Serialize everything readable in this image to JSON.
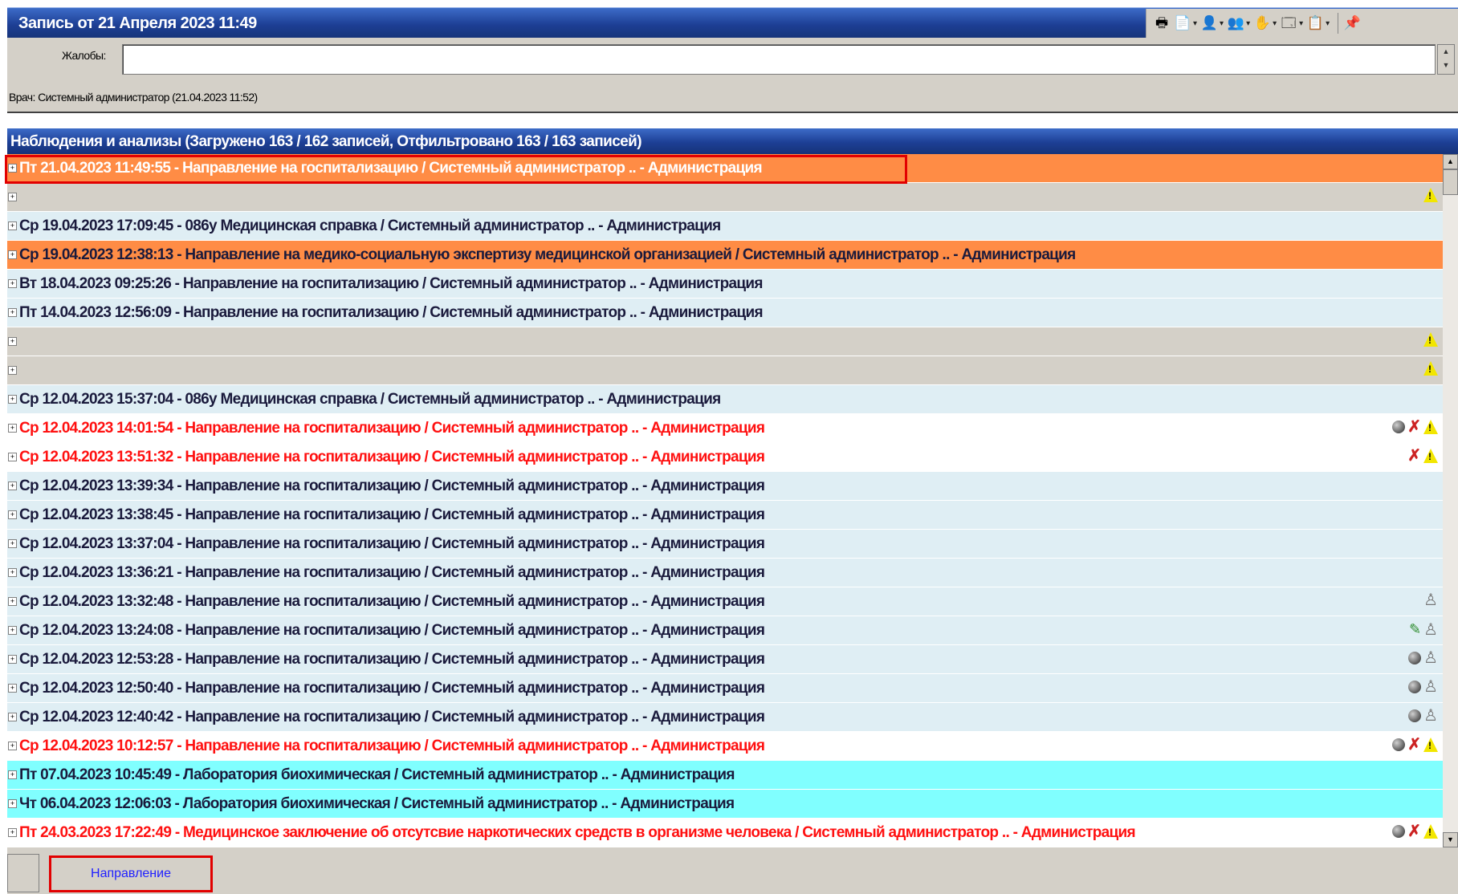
{
  "title": "Запись от 21 Апреля 2023 11:49",
  "toolbar": {
    "buttons": [
      {
        "name": "print-icon",
        "glyph": "🖶"
      },
      {
        "name": "document-icon",
        "glyph": "📄"
      },
      {
        "name": "doctor-icon",
        "glyph": "👤"
      },
      {
        "name": "doctors-icon",
        "glyph": "👥"
      },
      {
        "name": "hand-icon",
        "glyph": "✋"
      },
      {
        "name": "window-icon",
        "glyph": "🗔"
      },
      {
        "name": "copy-icon",
        "glyph": "📋"
      },
      {
        "name": "pin-icon",
        "glyph": "📌"
      }
    ]
  },
  "complaints": {
    "label": "Жалобы:",
    "value": ""
  },
  "doctor_line": "Врач: Системный администратор  (21.04.2023 11:52)",
  "observations_header": "Наблюдения и анализы (Загружено 163 / 162 записей, Отфильтровано 163 / 163 записей)",
  "rows": [
    {
      "text": "Пт 21.04.2023 11:49:55 - Направление на госпитализацию / Системный администратор .. - Администрация",
      "bg": "orange",
      "fg": "white",
      "icons": []
    },
    {
      "text": "",
      "bg": "gray",
      "fg": "dark",
      "icons": [
        "warn"
      ]
    },
    {
      "text": "Ср 19.04.2023 17:09:45 - 086у Медицинская справка / Системный администратор .. - Администрация",
      "bg": "light",
      "fg": "dark",
      "icons": []
    },
    {
      "text": "Ср 19.04.2023 12:38:13 - Направление на медико-социальную экспертизу медицинской организацией / Системный администратор .. - Администрация",
      "bg": "orange",
      "fg": "dark",
      "icons": []
    },
    {
      "text": "Вт 18.04.2023 09:25:26 - Направление на госпитализацию / Системный администратор .. - Администрация",
      "bg": "light",
      "fg": "dark",
      "icons": []
    },
    {
      "text": "Пт 14.04.2023 12:56:09 - Направление на госпитализацию / Системный администратор .. - Администрация",
      "bg": "light",
      "fg": "dark",
      "icons": []
    },
    {
      "text": "",
      "bg": "gray",
      "fg": "dark",
      "icons": [
        "warn"
      ]
    },
    {
      "text": "",
      "bg": "gray",
      "fg": "dark",
      "icons": [
        "warn"
      ]
    },
    {
      "text": "Ср 12.04.2023 15:37:04 - 086у Медицинская справка / Системный администратор .. - Администрация",
      "bg": "light",
      "fg": "dark",
      "icons": []
    },
    {
      "text": "Ср 12.04.2023 14:01:54 - Направление на госпитализацию / Системный администратор .. - Администрация",
      "bg": "white",
      "fg": "red",
      "icons": [
        "globe",
        "person-x",
        "warn"
      ]
    },
    {
      "text": "Ср 12.04.2023 13:51:32 - Направление на госпитализацию / Системный администратор .. - Администрация",
      "bg": "white",
      "fg": "red",
      "icons": [
        "person-x",
        "warn"
      ]
    },
    {
      "text": "Ср 12.04.2023 13:39:34 - Направление на госпитализацию / Системный администратор .. - Администрация",
      "bg": "light",
      "fg": "dark",
      "icons": []
    },
    {
      "text": "Ср 12.04.2023 13:38:45 - Направление на госпитализацию / Системный администратор .. - Администрация",
      "bg": "light",
      "fg": "dark",
      "icons": []
    },
    {
      "text": "Ср 12.04.2023 13:37:04 - Направление на госпитализацию / Системный администратор .. - Администрация",
      "bg": "light",
      "fg": "dark",
      "icons": []
    },
    {
      "text": "Ср 12.04.2023 13:36:21 - Направление на госпитализацию / Системный администратор .. - Администрация",
      "bg": "light",
      "fg": "dark",
      "icons": []
    },
    {
      "text": "Ср 12.04.2023 13:32:48 - Направление на госпитализацию / Системный администратор .. - Администрация",
      "bg": "light",
      "fg": "dark",
      "icons": [
        "person"
      ]
    },
    {
      "text": "Ср 12.04.2023 13:24:08 - Направление на госпитализацию / Системный администратор .. - Администрация",
      "bg": "light",
      "fg": "dark",
      "icons": [
        "pen",
        "person"
      ]
    },
    {
      "text": "Ср 12.04.2023 12:53:28 - Направление на госпитализацию / Системный администратор .. - Администрация",
      "bg": "light",
      "fg": "dark",
      "icons": [
        "globe",
        "person"
      ]
    },
    {
      "text": "Ср 12.04.2023 12:50:40 - Направление на госпитализацию / Системный администратор .. - Администрация",
      "bg": "light",
      "fg": "dark",
      "icons": [
        "globe",
        "person"
      ]
    },
    {
      "text": "Ср 12.04.2023 12:40:42 - Направление на госпитализацию / Системный администратор .. - Администрация",
      "bg": "light",
      "fg": "dark",
      "icons": [
        "globe",
        "person"
      ]
    },
    {
      "text": "Ср 12.04.2023 10:12:57 - Направление на госпитализацию / Системный администратор .. - Администрация",
      "bg": "white",
      "fg": "red",
      "icons": [
        "globe",
        "person-x",
        "warn"
      ]
    },
    {
      "text": "Пт 07.04.2023 10:45:49 - Лаборатория биохимическая / Системный администратор .. - Администрация",
      "bg": "cyan",
      "fg": "dark",
      "icons": []
    },
    {
      "text": "Чт 06.04.2023 12:06:03 - Лаборатория биохимическая / Системный администратор .. - Администрация",
      "bg": "cyan",
      "fg": "dark",
      "icons": []
    },
    {
      "text": "Пт 24.03.2023 17:22:49 - Медицинское заключение об отсутсвие наркотических средств в организме человека / Системный администратор .. - Администрация",
      "bg": "white",
      "fg": "red",
      "icons": [
        "globe",
        "person-x",
        "warn"
      ]
    }
  ],
  "bottom_tab": "Направление"
}
